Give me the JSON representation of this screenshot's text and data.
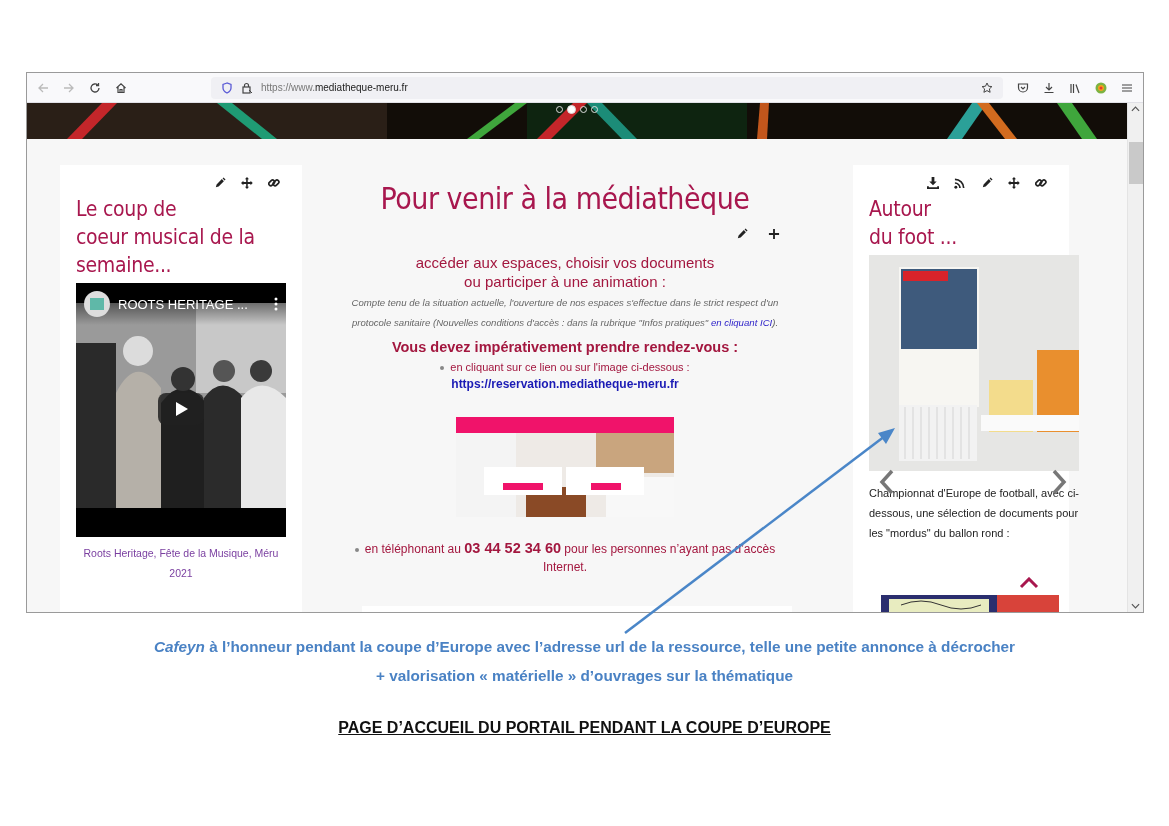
{
  "browser": {
    "url_prefix": "https://www.",
    "url_domain": "mediatheque-meru.fr"
  },
  "banner": {
    "dots": [
      {
        "selected": false
      },
      {
        "selected": true
      },
      {
        "selected": false
      },
      {
        "selected": false
      }
    ]
  },
  "left_card": {
    "title_lines": [
      "Le coup de",
      "coeur musical de la",
      "semaine..."
    ],
    "video": {
      "title": "ROOTS HERITAGE ..."
    },
    "caption": "Roots Heritage, Fête de la Musique, Méru 2021"
  },
  "center": {
    "heading": "Pour venir à la médiathèque",
    "intro_lines": [
      "accéder aux espaces, choisir vos documents",
      "ou participer à une animation :"
    ],
    "notice": {
      "text": "Compte tenu de la situation actuelle, l'ouverture de nos espaces s'effectue dans le strict respect d'un protocole sanitaire (Nouvelles conditions d'accès : dans la rubrique \"Infos pratiques\" ",
      "link": "en cliquant ICI",
      "text_after": ")."
    },
    "appointment_heading": "Vous devez impérativement prendre rendez-vous :",
    "bullets": [
      {
        "kind": "link",
        "text": "en cliquant sur ce lien ou sur l'image ci-dessous :",
        "link": "https://reservation.mediatheque-meru.fr"
      },
      {
        "kind": "phone",
        "text": "en téléphonant au **03 44 52 34 60** pour les personnes n’ayant pas d’accès Internet."
      }
    ]
  },
  "right_card": {
    "title_lines": [
      "Autour",
      "du foot ..."
    ],
    "caption": "Championnat d'Europe de football, avec ci-dessous, une sélection de documents pour les \"mordus\" du ballon rond :"
  },
  "annotation": {
    "lines": [
      "*Cafeyn* à l’honneur pendant la coupe d’Europe avec l’adresse url de la ressource, telle une petite annonce à décrocher",
      "+ valorisation « matérielle » d’ouvrages sur la thématique"
    ]
  },
  "page_title": "PAGE D’ACCUEIL DU PORTAIL PENDANT LA COUPE D’EUROPE"
}
